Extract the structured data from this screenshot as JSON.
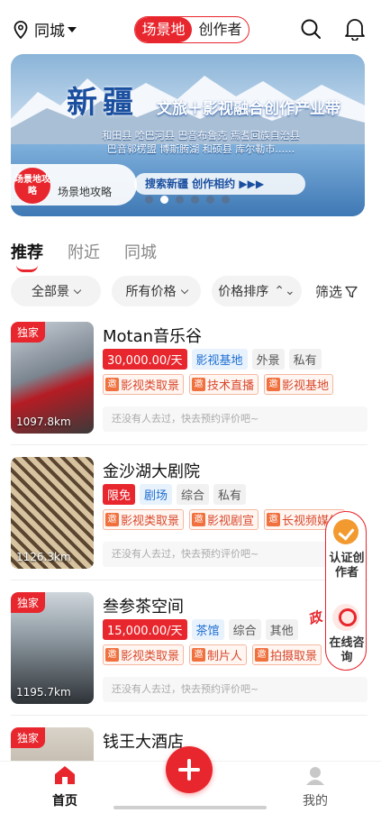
{
  "topbar": {
    "location": "同城",
    "segments": [
      "场景地",
      "创作者"
    ],
    "active_segment": 0
  },
  "banner": {
    "title": "新疆",
    "subtitle": "文旅＋影视融合创作产业带",
    "regions_line1": "和田县 哈巴河县 巴音布鲁克 焉耆回族自治县",
    "regions_line2": "巴音郭楞盟 博斯腾湖 和硕县 库尔勒市……",
    "badge": "场景地攻略",
    "tag_label": "场景地攻略",
    "search_text": "搜索新疆 创作相约 ▶▶▶",
    "slide_count": 6,
    "active_slide": 1
  },
  "tabs": [
    "推荐",
    "附近",
    "同城"
  ],
  "filters": {
    "all_areas": "全部景",
    "all_prices": "所有价格",
    "price_sort": "价格排序",
    "screen": "筛选"
  },
  "listings": [
    {
      "title": "Motan音乐谷",
      "exclusive": "独家",
      "distance": "1097.8km",
      "price": "30,000.00/天",
      "type": "影视基地",
      "tags": [
        "外景",
        "私有"
      ],
      "services": [
        "影视类取景",
        "技术直播",
        "影视基地"
      ],
      "review": "还没有人去过，快去预约评价吧~"
    },
    {
      "title": "金沙湖大剧院",
      "exclusive": "",
      "distance": "1126.3km",
      "price": "限免",
      "type": "剧场",
      "tags": [
        "综合",
        "私有"
      ],
      "services": [
        "影视类取景",
        "影视剧宣",
        "长视频媒体"
      ],
      "review": "还没有人去过，快去预约评价吧~"
    },
    {
      "title": "叁参茶空间",
      "exclusive": "独家",
      "distance": "1195.7km",
      "price": "15,000.00/天",
      "type": "茶馆",
      "tags": [
        "综合",
        "其他"
      ],
      "services": [
        "影视类取景",
        "制片人",
        "拍摄取景"
      ],
      "review": "还没有人去过，快去预约评价吧~"
    },
    {
      "title": "钱王大酒店",
      "exclusive": "独家",
      "distance": "",
      "price": "",
      "type": "",
      "tags": [],
      "services": [],
      "review": ""
    }
  ],
  "service_icon_char": "邀",
  "floating": {
    "certify": "认证创作者",
    "service": "在线咨询",
    "deco_text": "政"
  },
  "bottom_nav": {
    "home": "首页",
    "mine": "我的"
  },
  "colors": {
    "brand_red": "#e8262d",
    "tag_blue": "#1f6fd1",
    "service_orange": "#f0713e"
  }
}
